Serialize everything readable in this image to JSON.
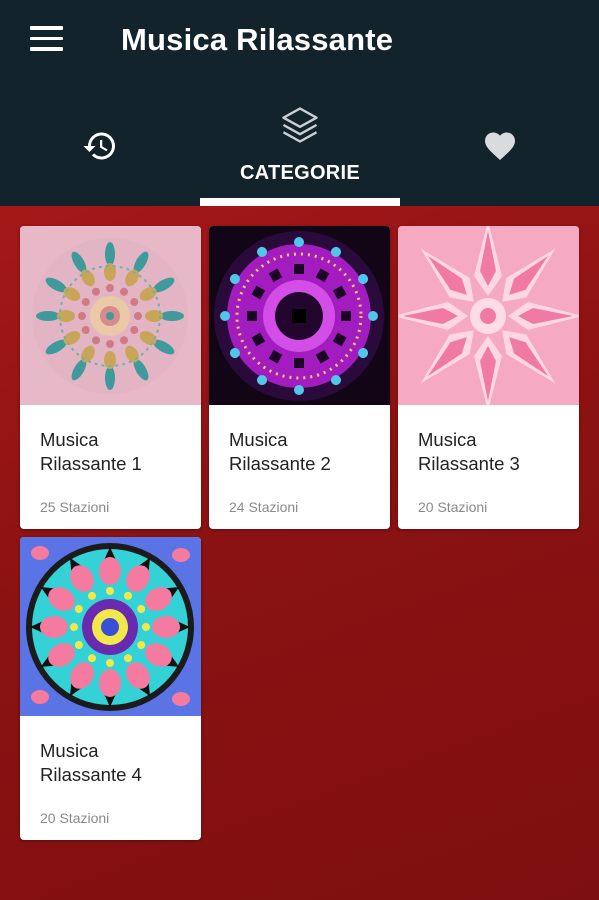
{
  "app": {
    "title": "Musica Rilassante"
  },
  "tabs": [
    {
      "icon": "history-icon",
      "label": ""
    },
    {
      "icon": "layers-icon",
      "label": "CATEGORIE"
    },
    {
      "icon": "heart-icon",
      "label": ""
    }
  ],
  "active_tab": 1,
  "colors": {
    "appbar": "#13232c",
    "background": "#8e1414",
    "card": "#ffffff",
    "indicator": "#ffffff"
  },
  "categories": [
    {
      "title": "Musica Rilassante 1",
      "subtitle": "25 Stazioni",
      "image": "mandala-pastel-image"
    },
    {
      "title": "Musica Rilassante 2",
      "subtitle": "24 Stazioni",
      "image": "mandala-purple-image"
    },
    {
      "title": "Musica Rilassante 3",
      "subtitle": "20 Stazioni",
      "image": "mandala-pink-image"
    },
    {
      "title": "Musica Rilassante 4",
      "subtitle": "20 Stazioni",
      "image": "mandala-flower-image"
    }
  ]
}
